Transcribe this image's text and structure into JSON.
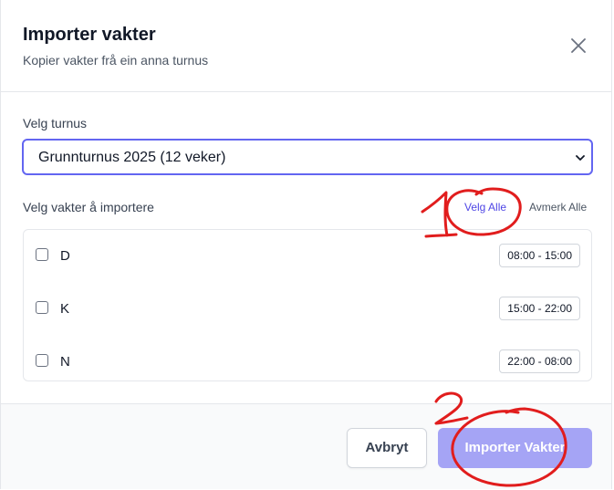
{
  "dialog": {
    "title": "Importer vakter",
    "subtitle": "Kopier vakter frå ein anna turnus",
    "close_icon": "close-icon"
  },
  "turnus": {
    "label": "Velg turnus",
    "selected": "Grunnturnus 2025 (12 veker)"
  },
  "shifts": {
    "label": "Velg vakter å importere",
    "select_all": "Velg Alle",
    "deselect_all": "Avmerk Alle",
    "items": [
      {
        "name": "D",
        "time": "08:00 - 15:00",
        "checked": false
      },
      {
        "name": "K",
        "time": "15:00 - 22:00",
        "checked": false
      },
      {
        "name": "N",
        "time": "22:00 - 08:00",
        "checked": false
      }
    ]
  },
  "footer": {
    "cancel": "Avbryt",
    "import": "Importer Vakter"
  },
  "annotations": {
    "color": "#e11d1d",
    "marks": [
      "1",
      "2"
    ]
  },
  "colors": {
    "accent": "#6366f1",
    "link": "#4f46e5",
    "import_button": "#a5a4f5"
  }
}
